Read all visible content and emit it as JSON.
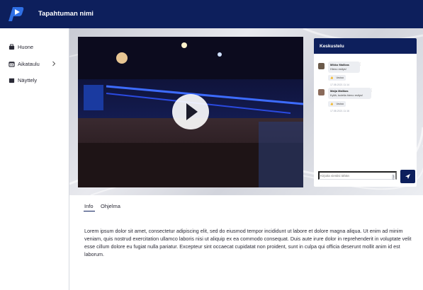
{
  "header": {
    "event_name": "Tapahtuman nimi"
  },
  "sidebar": {
    "items": [
      {
        "label": "Huone",
        "icon": "room-icon"
      },
      {
        "label": "Aikataulu",
        "icon": "calendar-icon",
        "has_submenu": true
      },
      {
        "label": "Näyttely",
        "icon": "exhibition-icon"
      }
    ]
  },
  "chat": {
    "title": "Keskustelu",
    "messages": [
      {
        "author": "Mikko Malikas",
        "text": "Hieno esitys!",
        "reaction": "Vastaa",
        "time": "17.08.2021 11:14"
      },
      {
        "author": "Maija Malikas",
        "text": "Kyllä, todella hieno esitys!",
        "reaction": "Vastaa",
        "time": "17.08.2021 11:16"
      }
    ],
    "input_placeholder": "Kirjoita viestisi tähän"
  },
  "tabs": [
    {
      "label": "Info",
      "active": true
    },
    {
      "label": "Ohjelma",
      "active": false
    }
  ],
  "info_text": "Lorem ipsum dolor sit amet, consectetur adipiscing elit, sed do eiusmod tempor incididunt ut labore et dolore magna aliqua. Ut enim ad minim veniam, quis nostrud exercitation ullamco laboris nisi ut aliquip ex ea commodo consequat. Duis aute irure dolor in reprehenderit in voluptate velit esse cillum dolore eu fugiat nulla pariatur. Excepteur sint occaecat cupidatat non proident, sunt in culpa qui officia deserunt mollit anim id est laborum.",
  "colors": {
    "brand_navy": "#0d1f5c",
    "logo_blue": "#2f6fe4"
  }
}
